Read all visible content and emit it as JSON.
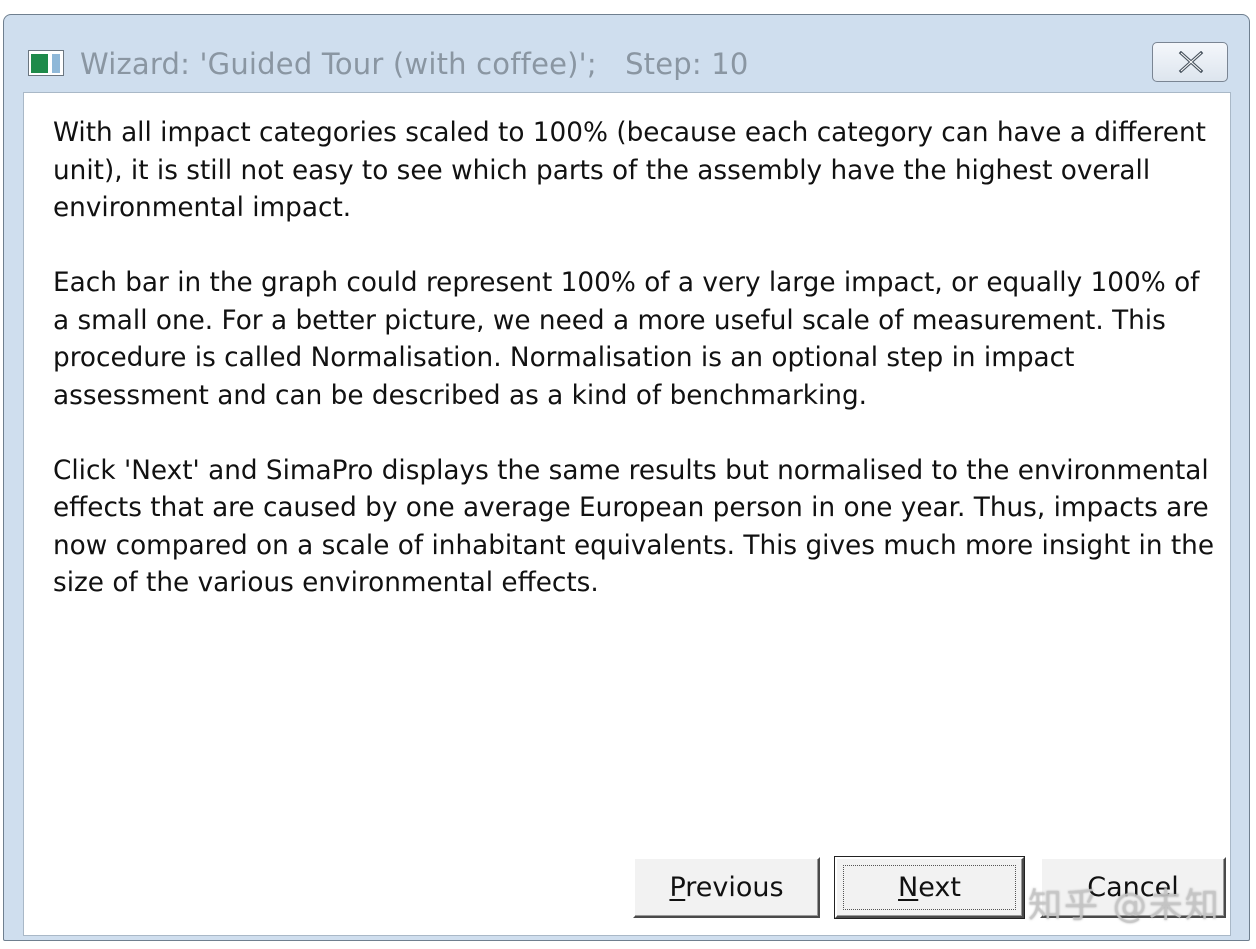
{
  "window": {
    "title": "Wizard: 'Guided Tour (with coffee)';   Step: 10"
  },
  "icons": {
    "app": "simapro-window-icon",
    "close": "close-icon"
  },
  "content": {
    "paragraphs": [
      "With all impact categories scaled to 100% (because each category can have a different unit), it is still not easy to see which parts of the assembly have the highest overall environmental impact.",
      "Each bar in the graph could represent 100% of a very large impact, or equally 100% of a small one. For a better picture, we need a more useful scale of measurement. This procedure is called Normalisation. Normalisation is an optional step in impact assessment and can be described as a kind of benchmarking.",
      "Click 'Next' and SimaPro displays the same results but normalised to the environmental effects that are caused by one average European person in one year. Thus, impacts are now compared on a scale of inhabitant equivalents. This gives much more insight in the size of the various environmental effects."
    ]
  },
  "buttons": {
    "previous": {
      "mnemonic": "P",
      "rest": "revious"
    },
    "next": {
      "mnemonic": "N",
      "rest": "ext"
    },
    "cancel": {
      "label": "Cancel"
    }
  },
  "watermark": "知乎 @未知"
}
